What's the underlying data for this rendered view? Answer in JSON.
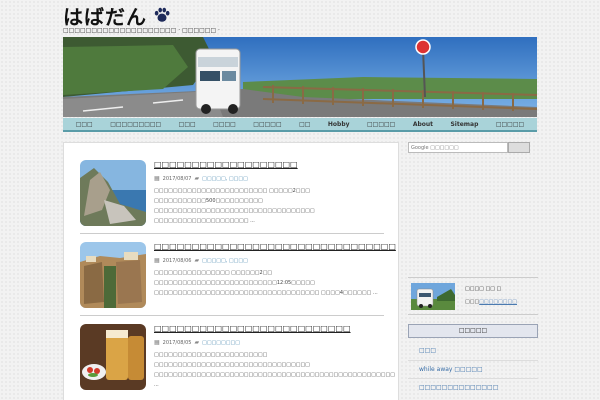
{
  "site": {
    "title": "はばだん",
    "tagline": "□□□□□□□□□□□□□□□□□□□□ · □□□□□□ ·"
  },
  "nav": {
    "items": [
      "□□□",
      "□□□□□□□□□",
      "□□□",
      "□□□□",
      "□□□□□",
      "□□",
      "Hobby",
      "□□□□□",
      "About",
      "Sitemap",
      "□□□□□"
    ]
  },
  "posts": [
    {
      "title": "□□□□□□□□□□□□□□□□□□□",
      "date": "2017/08/07",
      "categories": "□□□□□, □□□□",
      "excerpt": "□□□□□□□□□□□□□□□□□□□□□□□□ □□□□□2□□□ □□□□□□□□□□□500□□□□□□□□□□ □□□□□□□□□□□□□□□□□□□□□□□□□□□□□□□□□□ □□□□□□□□□□□□□□□□□□□□ ..."
    },
    {
      "title": "□□□□□□□□□□□□□□□□□□□□□□□□□□□□□□□□",
      "date": "2017/08/06",
      "categories": "□□□□□, □□□□",
      "excerpt": "□□□□□□□□□□□□□□□□ □□□□□□2□□ □□□□□□□□□□□□□□□□□□□□□□□□□□12:05□□□□□ □□□□□□□□□□□□□□□□□□□□□□□□□□□□□□□□□□□ □□□□4□□□□□□ ..."
    },
    {
      "title": "□□□□□□□□□□□□□□□□□□□□□□□□□□",
      "date": "2017/08/05",
      "categories": "□□□□□□□□",
      "excerpt": "□□□□□□□□□□□□□□□□□□□□□□□□ □□□□□□□□□□□□□□□□□□□□□□□□□□□□□□□□□ □□□□□□□□□□□□□□□□□□□□□□□□□□□□□□□□□□□□□□□□□□□□□□□□□□□ ..."
    }
  ],
  "sidebar": {
    "search_placeholder": "Google □□□□□□",
    "profile_name": "□□□□ □□ □",
    "profile_prefix": "□□□",
    "profile_link": "□□□□□□□□",
    "categories_header": "□□□□□",
    "links": [
      "□□□",
      "while away □□□□□",
      "□□□□□□□□□□□□□□"
    ]
  },
  "colors": {
    "nav_bg": "#a9d3d9",
    "nav_border": "#5a9ca8",
    "link": "#3a6fa8"
  }
}
